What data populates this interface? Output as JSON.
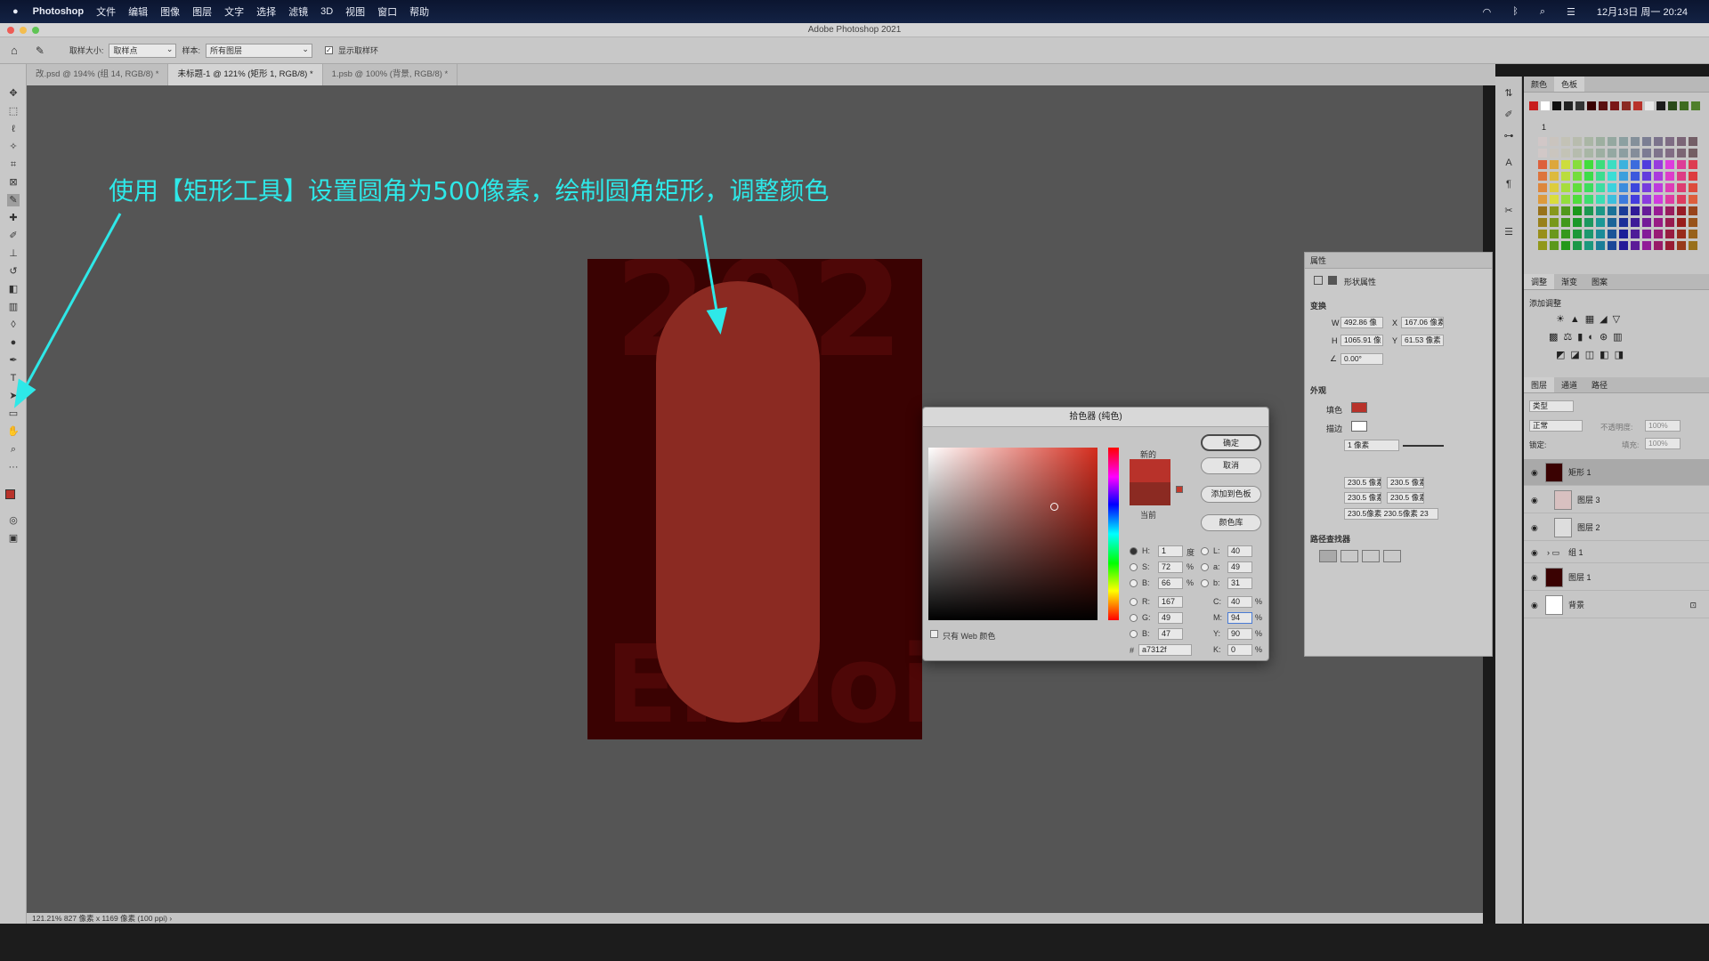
{
  "menubar": {
    "app": "Photoshop",
    "items": [
      "文件",
      "编辑",
      "图像",
      "图层",
      "文字",
      "选择",
      "滤镜",
      "3D",
      "视图",
      "窗口",
      "帮助"
    ],
    "clock": "12月13日 周一 20:24"
  },
  "window": {
    "title": "Adobe Photoshop 2021"
  },
  "options": {
    "sample_size_label": "取样大小:",
    "sample_size_value": "取样点",
    "sample_label": "样本:",
    "sample_value": "所有图层",
    "show_ring_label": "显示取样环"
  },
  "tabs": [
    {
      "label": "改.psd @ 194% (组 14, RGB/8) *"
    },
    {
      "label": "未标题-1 @ 121% (矩形 1, RGB/8) *"
    },
    {
      "label": "1.psb @ 100% (背景, RGB/8) *"
    }
  ],
  "caption": "使用【矩形工具】设置圆角为500像素，绘制圆角矩形，调整颜色",
  "statusbar": {
    "text": "121.21%  827 像素 x 1169 像素 (100 ppi)  ›"
  },
  "picker": {
    "title": "拾色器 (纯色)",
    "new_label": "新的",
    "current_label": "当前",
    "ok": "确定",
    "cancel": "取消",
    "add_swatch": "添加到色板",
    "color_lib": "颜色库",
    "web_only": "只有 Web 颜色",
    "h": "1",
    "s": "72",
    "b": "66",
    "r": "167",
    "g": "49",
    "b2": "47",
    "l": "40",
    "a": "49",
    "lab_b": "31",
    "c": "40",
    "m": "94",
    "y": "90",
    "k": "0",
    "hex": "a7312f",
    "deg": "度",
    "pct": "%",
    "new_color": "#b8322a",
    "current_color": "#8b2a22"
  },
  "properties": {
    "tab": "属性",
    "type": "形状属性",
    "transform": "变换",
    "w": "492.86 像",
    "x": "167.06 像素",
    "h": "1065.91 像",
    "y": "61.53 像素",
    "angle": "0.00°",
    "appearance": "外观",
    "fill_label": "填色",
    "stroke_label": "描边",
    "stroke_width": "1 像素",
    "r1": "230.5 像素",
    "r2": "230.5 像素",
    "r3": "230.5 像素",
    "r4": "230.5 像素",
    "radius_all": "230.5像素 230.5像素 23",
    "pathfinder": "路径查找器"
  },
  "right": {
    "color_tabs": [
      "颜色",
      "色板"
    ],
    "group_label": "1",
    "adj_tabs": [
      "调整",
      "渐变",
      "图案"
    ],
    "adj_title": "添加调整",
    "layer_tabs": [
      "图层",
      "通道",
      "路径"
    ],
    "filter_label": "类型",
    "blend": "正常",
    "opacity_label": "不透明度:",
    "opacity": "100%",
    "lock_label": "锁定:",
    "fill_label": "填充:",
    "fill": "100%",
    "layers": [
      {
        "name": "矩形 1"
      },
      {
        "name": "图层 3"
      },
      {
        "name": "图层 2"
      },
      {
        "name": "组 1"
      },
      {
        "name": "图层 1"
      },
      {
        "name": "背景"
      }
    ]
  },
  "colors": {
    "cyan": "#2ee8e8",
    "shape": "#8b2a22",
    "doc_bg": "#3a0202"
  }
}
